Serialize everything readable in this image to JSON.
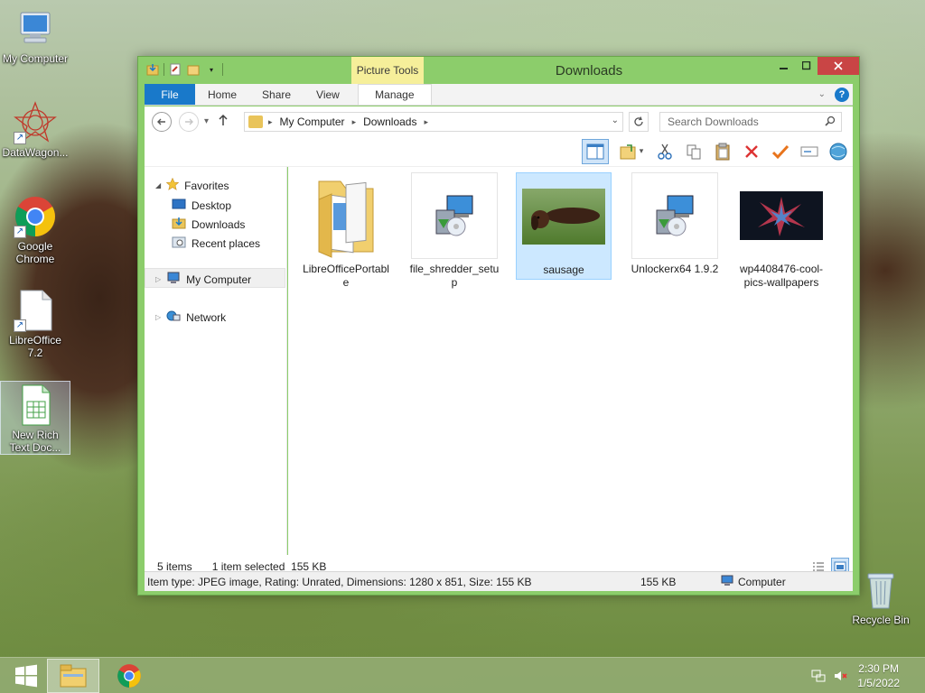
{
  "desktop": {
    "icons": [
      {
        "label": "My Computer"
      },
      {
        "label": "DataWagon..."
      },
      {
        "label": "Google Chrome"
      },
      {
        "label": "LibreOffice 7.2"
      },
      {
        "label": "New Rich Text Doc..."
      },
      {
        "label": "Recycle Bin"
      }
    ]
  },
  "window": {
    "title": "Downloads",
    "context_tab": "Picture Tools",
    "tabs": [
      {
        "label": "File"
      },
      {
        "label": "Home"
      },
      {
        "label": "Share"
      },
      {
        "label": "View"
      },
      {
        "label": "Manage"
      }
    ],
    "address": {
      "crumbs": [
        "My Computer",
        "Downloads"
      ]
    },
    "search": {
      "placeholder": "Search Downloads"
    },
    "nav": {
      "favorites": "Favorites",
      "desktop": "Desktop",
      "downloads": "Downloads",
      "recent": "Recent places",
      "my_computer": "My Computer",
      "network": "Network"
    },
    "files": [
      {
        "name": "LibreOfficePortable"
      },
      {
        "name": "file_shredder_setup"
      },
      {
        "name": "sausage"
      },
      {
        "name": "Unlockerx64 1.9.2"
      },
      {
        "name": "wp4408476-cool-pics-wallpapers"
      }
    ],
    "status": {
      "count": "5 items",
      "selected": "1 item selected  155 KB"
    },
    "details": {
      "info": "Item type: JPEG image, Rating: Unrated, Dimensions: 1280 x 851, Size: 155 KB",
      "size": "155 KB",
      "location": "Computer"
    }
  },
  "taskbar": {
    "time": "2:30 PM",
    "date": "1/5/2022"
  },
  "colors": {
    "accent": "#1979ca",
    "window_frame": "#8ccd6b",
    "selection": "#cce8ff",
    "close": "#c94545"
  }
}
